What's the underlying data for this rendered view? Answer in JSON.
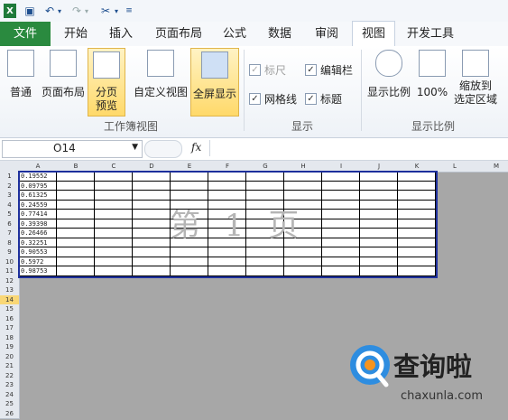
{
  "ribbon_tabs": [
    "文件",
    "开始",
    "插入",
    "页面布局",
    "公式",
    "数据",
    "审阅",
    "视图",
    "开发工具"
  ],
  "active_tab": "视图",
  "workbook_views": {
    "buttons": [
      "普通",
      "页面布局",
      "分页\n预览",
      "自定义视图",
      "全屏显示"
    ],
    "group": "工作簿视图"
  },
  "show": {
    "items": [
      {
        "label": "标尺",
        "checked": true,
        "disabled": true
      },
      {
        "label": "编辑栏",
        "checked": true,
        "disabled": false
      },
      {
        "label": "网格线",
        "checked": true,
        "disabled": false
      },
      {
        "label": "标题",
        "checked": true,
        "disabled": false
      }
    ],
    "group": "显示"
  },
  "zoom": {
    "buttons": [
      "显示比例",
      "100%",
      "缩放到\n选定区域"
    ],
    "group": "显示比例"
  },
  "formula_bar": {
    "name_box": "O14",
    "fx": "fx",
    "formula": ""
  },
  "columns": [
    "A",
    "B",
    "C",
    "D",
    "E",
    "F",
    "G",
    "H",
    "I",
    "J",
    "K",
    "L",
    "M"
  ],
  "rows": [
    "1",
    "2",
    "3",
    "4",
    "5",
    "6",
    "7",
    "8",
    "9",
    "10",
    "11",
    "12",
    "13",
    "14",
    "15",
    "16",
    "17",
    "18",
    "19",
    "20",
    "21",
    "22",
    "23",
    "24",
    "25",
    "26"
  ],
  "column_a": [
    "0.19552",
    "0.09795",
    "0.61325",
    "0.24559",
    "0.77414",
    "0.39398",
    "0.26466",
    "0.32251",
    "0.90553",
    "0.5972",
    "0.98753"
  ],
  "watermark": "第 1 页",
  "logo": {
    "name": "查询啦",
    "url": "chaxunla.com"
  }
}
